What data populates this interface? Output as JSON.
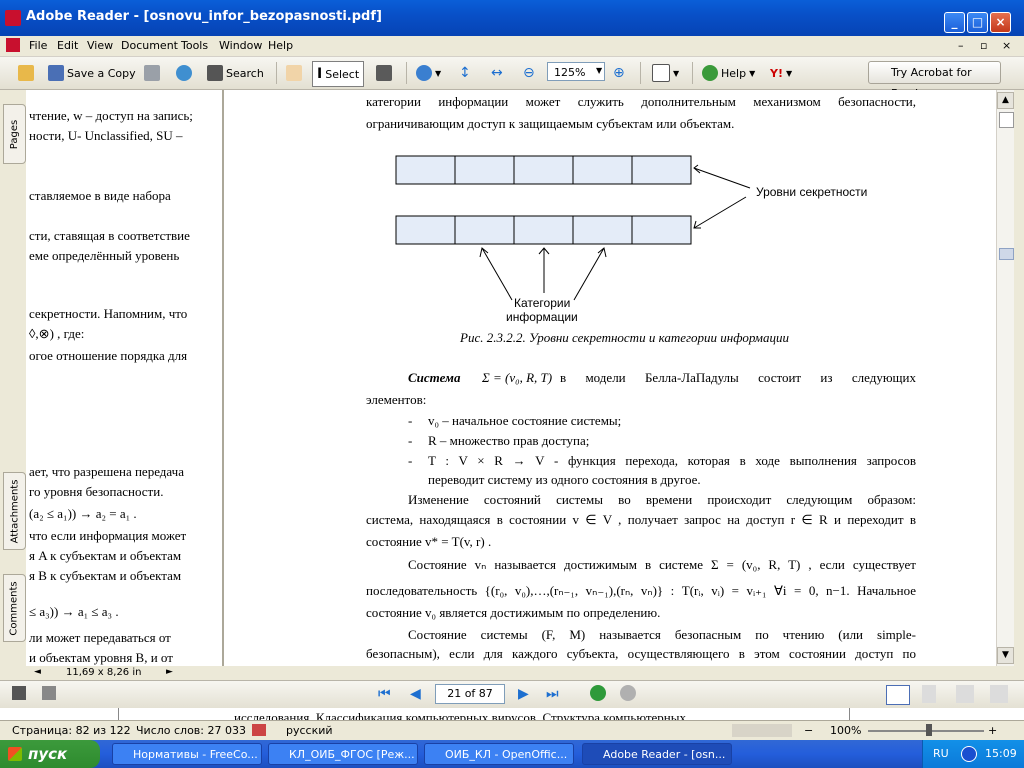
{
  "window": {
    "title": "Adobe Reader - [osnovu_infor_bezopasnosti.pdf]"
  },
  "menu": [
    "File",
    "Edit",
    "View",
    "Document",
    "Tools",
    "Window",
    "Help"
  ],
  "toolbar": {
    "save_copy": "Save a Copy",
    "search": "Search",
    "select": "Select",
    "zoom": "125%",
    "help": "Help",
    "try_acrobat": "Try Acrobat for Free!"
  },
  "side_tabs": {
    "pages": "Pages",
    "attachments": "Attachments",
    "comments": "Comments"
  },
  "left_page": {
    "lines": [
      "чтение, w – доступ на запись;",
      "ности, U- Unclassified, SU –",
      "ставляемое в виде набора",
      "сти, ставящая в соответствие",
      "еме определённый уровень",
      "секретности. Напомним, что",
      "◊,⊗) , где:",
      "огое отношение порядка для",
      "ает, что разрешена передача",
      "го уровня безопасности.",
      "(a₂ ≤ a₁)) → a₂ = a₁ .",
      "что если информация может",
      "я A к субъектам и объектам",
      "я B к субъектам и объектам",
      "≤ a₃)) → a₁ ≤ a₃ .",
      "ли может передаваться от",
      "и объектам уровня B, и от"
    ],
    "size": "11,69 x 8,26 in"
  },
  "doc": {
    "intro1": "категории информации может служить дополнительным механизмом безопасности,",
    "intro2": "ограничивающим доступ к защищаемым субъектам или объектам.",
    "label_levels": "Уровни секретности",
    "label_categories_1": "Категории",
    "label_categories_2": "информации",
    "caption": "Рис. 2.3.2.2. Уровни секретности и категории информации",
    "sys_word": "Система",
    "sys_formula": "Σ = (v₀, R, T)",
    "sys_rest": "в модели Белла-ЛаПадулы состоит из следующих",
    "elements": "элементов:",
    "b1": "v₀ – начальное состояние системы;",
    "b2": "R – множество прав доступа;",
    "b3a": "T : V × R → V  - функция перехода, которая в ходе выполнения запросов",
    "b3b": "переводит систему из одного состояния в другое.",
    "para1": "Изменение состояний системы во времени происходит следующим образом:",
    "para2": "система, находящаяся в состоянии  v ∈ V , получает запрос на доступ  r ∈ R  и переходит в",
    "para3": "состояние  v* = T(v, r) .",
    "para4": "Состояние vₙ называется достижимым в системе  Σ = (v₀, R, T) , если существует",
    "para5": "последовательность   {(r₀, v₀),…,(rₙ₋₁, vₙ₋₁),(rₙ, vₙ)} : T(rᵢ, vᵢ) = vᵢ₊₁ ∀i = 0, n−1.     Начальное",
    "para6": "состояние v₀ является достижимым по определению.",
    "para7": "Состояние системы (F, M) называется безопасным по чтению (или simple-",
    "para8": "безопасным), если для каждого субъекта, осуществляющего в этом состоянии доступ по"
  },
  "nav": {
    "page_display": "21 of 87"
  },
  "writer_strip": "исследования. Классификация компьютерных вирусов. Структура компьютерных",
  "writer_status": {
    "page": "Страница: 82 из 122",
    "words": "Число слов: 27 033",
    "lang": "русский",
    "zoom": "100%"
  },
  "taskbar": {
    "start": "пуск",
    "tasks": [
      "Нормативы - FreeCo...",
      "КЛ_ОИБ_ФГОС [Реж...",
      "ОИБ_КЛ - OpenOffic...",
      "Adobe Reader - [osn..."
    ],
    "lang": "RU",
    "clock": "15:09"
  }
}
